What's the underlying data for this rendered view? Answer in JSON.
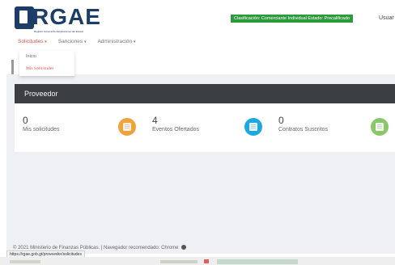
{
  "header": {
    "logo_text": "RGAE",
    "logo_subtitle": "Registro General de Adquisiciones del Estado",
    "classification_badge": "Clasificación: Comerciante Individual    Estado: Precalificado",
    "user_label": "Usuar"
  },
  "nav": {
    "items": [
      {
        "label": "Solicitudes",
        "active": true
      },
      {
        "label": "Sanciones",
        "active": false
      },
      {
        "label": "Administración",
        "active": false
      }
    ],
    "caret": "▾"
  },
  "dropdown": {
    "items": [
      {
        "label": "Inicio"
      },
      {
        "label": "Mis Solicitudes"
      }
    ]
  },
  "panel": {
    "title": "Proveedor",
    "stats": [
      {
        "count": "0",
        "label": "Mis solicitudes",
        "icon": "calendar-icon",
        "color": "#f0a33a"
      },
      {
        "count": "4",
        "label": "Eventos Ofertados",
        "icon": "list-icon",
        "color": "#1fa7e0"
      },
      {
        "count": "0",
        "label": "Contratos Suscritos",
        "icon": "document-icon",
        "color": "#8cc66b"
      }
    ]
  },
  "footer": {
    "text": "© 2021 Ministerio de Finanzas Públicas.  |  Navegador recomendado: Chrome"
  },
  "status_bar": {
    "url": "https://rgae.gob.gt/proveedor/solicitudes"
  },
  "colors": {
    "brand": "#1d3d69",
    "accent_red": "#d9534f",
    "panel_header": "#3b3f44",
    "badge_green": "#2d9a3d"
  }
}
